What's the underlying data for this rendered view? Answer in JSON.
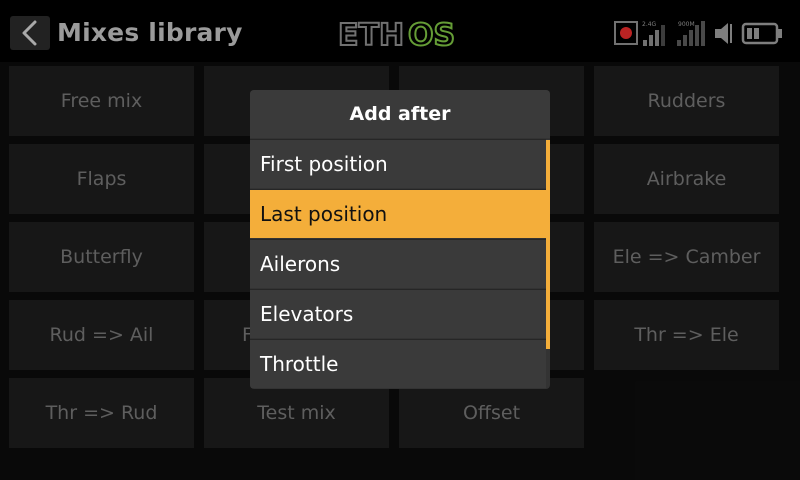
{
  "header": {
    "title": "Mixes library",
    "logo_text": "ETHOS",
    "signal_24": "2.4G",
    "signal_900": "900M"
  },
  "grid": {
    "cells": [
      "Free mix",
      "",
      "",
      "Rudders",
      "Flaps",
      "",
      "",
      "Airbrake",
      "Butterfly",
      "",
      "",
      "Ele => Camber",
      "Rud => Ail",
      "",
      "",
      "Thr => Ele",
      "Thr => Rud",
      "Test mix",
      "Offset"
    ],
    "partial_fragment": "F"
  },
  "dialog": {
    "title": "Add after",
    "options": [
      "First position",
      "Last position",
      "Ailerons",
      "Elevators",
      "Throttle"
    ],
    "selected_index": 1
  },
  "colors": {
    "accent": "#f4ae3a",
    "logo_green": "#7cc043",
    "record": "#e52b2b"
  }
}
